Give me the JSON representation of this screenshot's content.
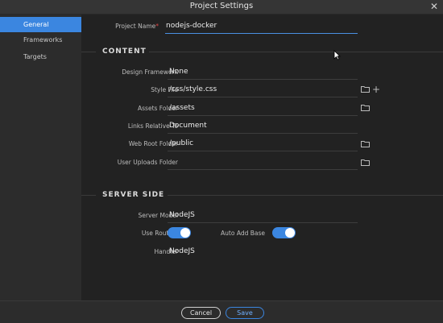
{
  "window": {
    "title": "Project Settings",
    "close_glyph": "✕"
  },
  "sidebar": {
    "items": [
      {
        "label": "General",
        "active": true
      },
      {
        "label": "Frameworks",
        "active": false
      },
      {
        "label": "Targets",
        "active": false
      }
    ]
  },
  "general": {
    "project_name_label": "Project Name",
    "required_marker": "*",
    "project_name_value": "nodejs-docker"
  },
  "content_section": {
    "heading": "CONTENT",
    "design_framework": {
      "label": "Design Framework",
      "value": "None"
    },
    "style_file": {
      "label": "Style File",
      "value": "/css/style.css"
    },
    "assets_folder": {
      "label": "Assets Folder",
      "value": "/assets"
    },
    "links_relative_to": {
      "label": "Links Relative To",
      "value": "Document"
    },
    "web_root_folder": {
      "label": "Web Root Folder",
      "value": "/public"
    },
    "user_uploads_folder": {
      "label": "User Uploads Folder",
      "value": ""
    }
  },
  "server_section": {
    "heading": "SERVER SIDE",
    "server_model": {
      "label": "Server Model",
      "value": "NodeJS"
    },
    "use_routing": {
      "label": "Use Routing",
      "on": true
    },
    "auto_add_base": {
      "label": "Auto Add Base",
      "on": true
    },
    "handler": {
      "label": "Handler",
      "value": "NodeJS"
    }
  },
  "footer": {
    "cancel_label": "Cancel",
    "save_label": "Save"
  },
  "icons": {
    "folder": "folder-icon",
    "add": "plus-icon"
  },
  "colors": {
    "accent": "#3b86e0",
    "required": "#e04747"
  }
}
